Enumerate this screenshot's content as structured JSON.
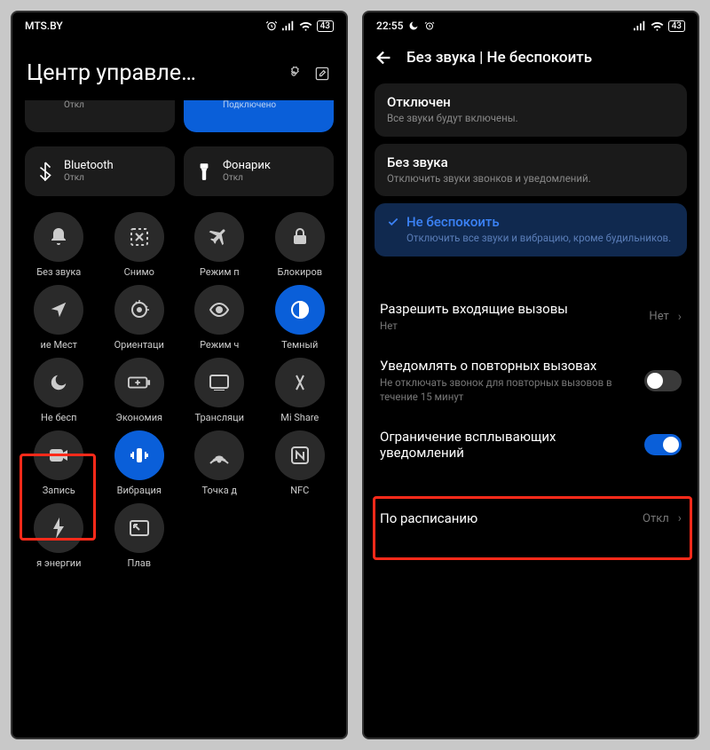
{
  "left": {
    "carrier": "MTS.BY",
    "battery": "43",
    "title": "Центр управле…",
    "tiles_top": [
      {
        "label": "",
        "sub": "Откл",
        "active": false
      },
      {
        "label": "",
        "sub": "Подключено",
        "active": true
      }
    ],
    "tiles_mid": [
      {
        "label": "Bluetooth",
        "sub": "Откл",
        "icon": "bluetooth"
      },
      {
        "label": "Фонарик",
        "sub": "Откл",
        "icon": "flashlight"
      }
    ],
    "grid": [
      {
        "label": "Без звука",
        "icon": "bell",
        "active": false
      },
      {
        "label": "Снимо",
        "icon": "screenshot",
        "active": false
      },
      {
        "label": "Режим п",
        "icon": "airplane",
        "active": false
      },
      {
        "label": "Блокиров",
        "icon": "lock",
        "active": false
      },
      {
        "label": "ие    Мест",
        "icon": "location",
        "active": false
      },
      {
        "label": "Ориентаци",
        "icon": "rotation",
        "active": false
      },
      {
        "label": "Режим ч",
        "icon": "eye",
        "active": false
      },
      {
        "label": "Темный",
        "icon": "contrast",
        "active": true
      },
      {
        "label": "Не бесп",
        "icon": "moon",
        "active": false
      },
      {
        "label": "Экономия",
        "icon": "battery-plus",
        "active": false
      },
      {
        "label": "Трансляци",
        "icon": "cast",
        "active": false
      },
      {
        "label": "Mi Share",
        "icon": "mishare",
        "active": false
      },
      {
        "label": "Запись",
        "icon": "record",
        "active": false
      },
      {
        "label": "Вибрация",
        "icon": "vibrate",
        "active": true
      },
      {
        "label": "Точка д",
        "icon": "hotspot",
        "active": false
      },
      {
        "label": "NFC",
        "icon": "nfc",
        "active": false
      },
      {
        "label": "я энергии",
        "icon": "bolt",
        "active": false
      },
      {
        "label": "Плав",
        "icon": "pip",
        "active": false
      }
    ]
  },
  "right": {
    "time": "22:55",
    "battery": "43",
    "title": "Без звука | Не беспокоить",
    "options": [
      {
        "title": "Отключен",
        "sub": "Все звуки будут включены.",
        "active": false
      },
      {
        "title": "Без звука",
        "sub": "Отключить звуки звонков и уведомлений.",
        "active": false
      },
      {
        "title": "Не беспокоить",
        "sub": "Отключить все звуки и вибрацию, кроме будильников.",
        "active": true
      }
    ],
    "rows": {
      "allow_calls": {
        "title": "Разрешить входящие вызовы",
        "sub": "Нет",
        "value": "Нет"
      },
      "repeat_calls": {
        "title": "Уведомлять о повторных вызовах",
        "sub": "Не отключать звонок для повторных вызовов в течение 15 минут",
        "on": false
      },
      "popup_limit": {
        "title": "Ограничение всплывающих уведомлений",
        "on": true
      },
      "schedule": {
        "title": "По расписанию",
        "value": "Откл"
      }
    }
  }
}
